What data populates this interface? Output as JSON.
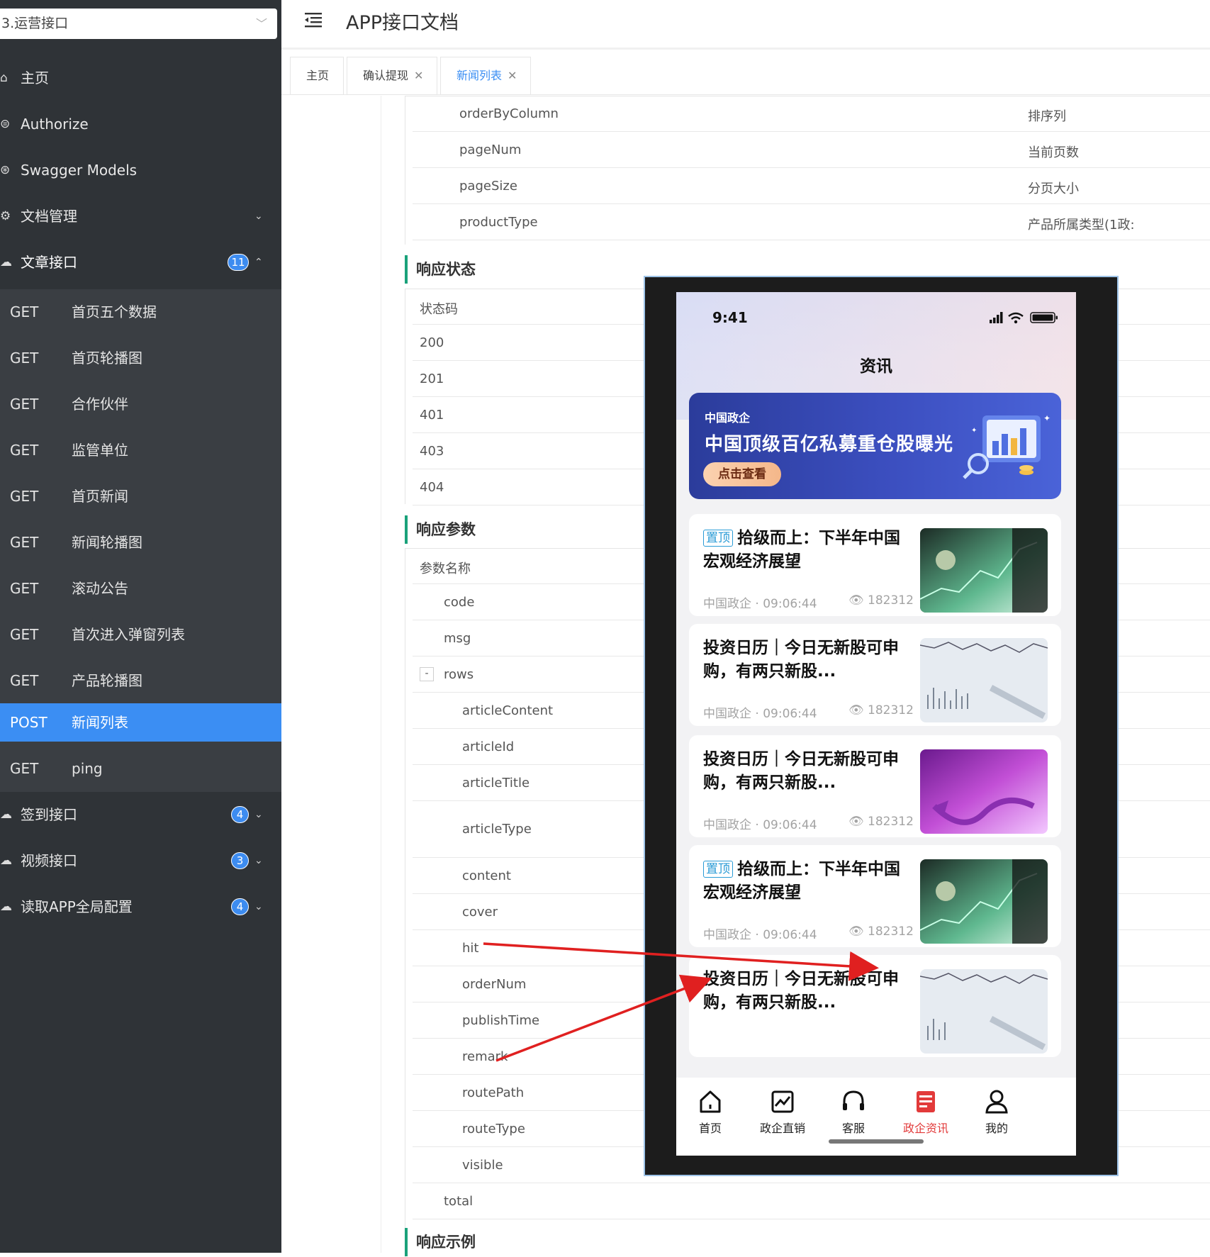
{
  "sidebar": {
    "project_select": "3.运营接口",
    "menu": [
      {
        "label": "主页"
      },
      {
        "label": "Authorize"
      },
      {
        "label": "Swagger Models"
      },
      {
        "label": "文档管理"
      },
      {
        "label": "文章接口",
        "badge": "11"
      }
    ],
    "endpoints": [
      {
        "method": "GET",
        "name": "首页五个数据"
      },
      {
        "method": "GET",
        "name": "首页轮播图"
      },
      {
        "method": "GET",
        "name": "合作伙伴"
      },
      {
        "method": "GET",
        "name": "监管单位"
      },
      {
        "method": "GET",
        "name": "首页新闻"
      },
      {
        "method": "GET",
        "name": "新闻轮播图"
      },
      {
        "method": "GET",
        "name": "滚动公告"
      },
      {
        "method": "GET",
        "name": "首次进入弹窗列表"
      },
      {
        "method": "GET",
        "name": "产品轮播图"
      },
      {
        "method": "POST",
        "name": "新闻列表"
      },
      {
        "method": "GET",
        "name": "ping"
      }
    ],
    "groups": [
      {
        "label": "签到接口",
        "badge": "4"
      },
      {
        "label": "视频接口",
        "badge": "3"
      },
      {
        "label": "读取APP全局配置",
        "badge": "4"
      }
    ]
  },
  "header": {
    "title": "APP接口文档",
    "tabs": [
      {
        "label": "主页"
      },
      {
        "label": "确认提现"
      },
      {
        "label": "新闻列表"
      }
    ]
  },
  "doc": {
    "request_rows": [
      {
        "name": "orderByColumn",
        "desc": "排序列"
      },
      {
        "name": "pageNum",
        "desc": "当前页数"
      },
      {
        "name": "pageSize",
        "desc": "分页大小"
      },
      {
        "name": "productType",
        "desc": "产品所属类型(1政:"
      }
    ],
    "response_status_title": "响应状态",
    "status_header": "状态码",
    "status_codes": [
      "200",
      "201",
      "401",
      "403",
      "404"
    ],
    "response_params_title": "响应参数",
    "params_header": "参数名称",
    "params_top": [
      "code",
      "msg",
      "rows"
    ],
    "rows_toggle": "-",
    "params_nested": [
      "articleContent",
      "articleId",
      "articleTitle",
      "articleType",
      "content",
      "cover",
      "hit",
      "orderNum",
      "publishTime",
      "remark",
      "routePath",
      "routeType",
      "visible"
    ],
    "params_bottom": [
      "total"
    ],
    "response_example_title": "响应示例"
  },
  "phone": {
    "time": "9:41",
    "nav_title": "资讯",
    "banner": {
      "brand": "中国政企",
      "headline": "中国顶级百亿私募重仓股曝光",
      "cta": "点击查看"
    },
    "pin_label": "置顶",
    "news": [
      {
        "pinned": true,
        "title": "拾级而上：下半年中国宏观经济展望",
        "source": "中国政企 · 09:06:44",
        "views": "182312"
      },
      {
        "pinned": false,
        "title": "投资日历｜今日无新股可申购，有两只新股...",
        "source": "中国政企 · 09:06:44",
        "views": "182312"
      },
      {
        "pinned": false,
        "title": "投资日历｜今日无新股可申购，有两只新股...",
        "source": "中国政企 · 09:06:44",
        "views": "182312"
      },
      {
        "pinned": true,
        "title": "拾级而上：下半年中国宏观经济展望",
        "source": "中国政企 · 09:06:44",
        "views": "182312"
      },
      {
        "pinned": false,
        "title": "投资日历｜今日无新股可申购，有两只新股...",
        "source": "中国政企 · 09:06:44",
        "views": "182312"
      }
    ],
    "tabbar": [
      {
        "label": "首页",
        "icon": "home-icon"
      },
      {
        "label": "政企直销",
        "icon": "chart-icon"
      },
      {
        "label": "客服",
        "icon": "headset-icon"
      },
      {
        "label": "政企资讯",
        "icon": "news-icon",
        "active": true
      },
      {
        "label": "我的",
        "icon": "user-icon"
      }
    ]
  },
  "colors": {
    "sidebar_bg": "#2f3337",
    "active_blue": "#3b8ef3",
    "section_accent": "#1aa27a",
    "tab_active_red": "#e23a3a",
    "arrow_red": "#e02020"
  }
}
